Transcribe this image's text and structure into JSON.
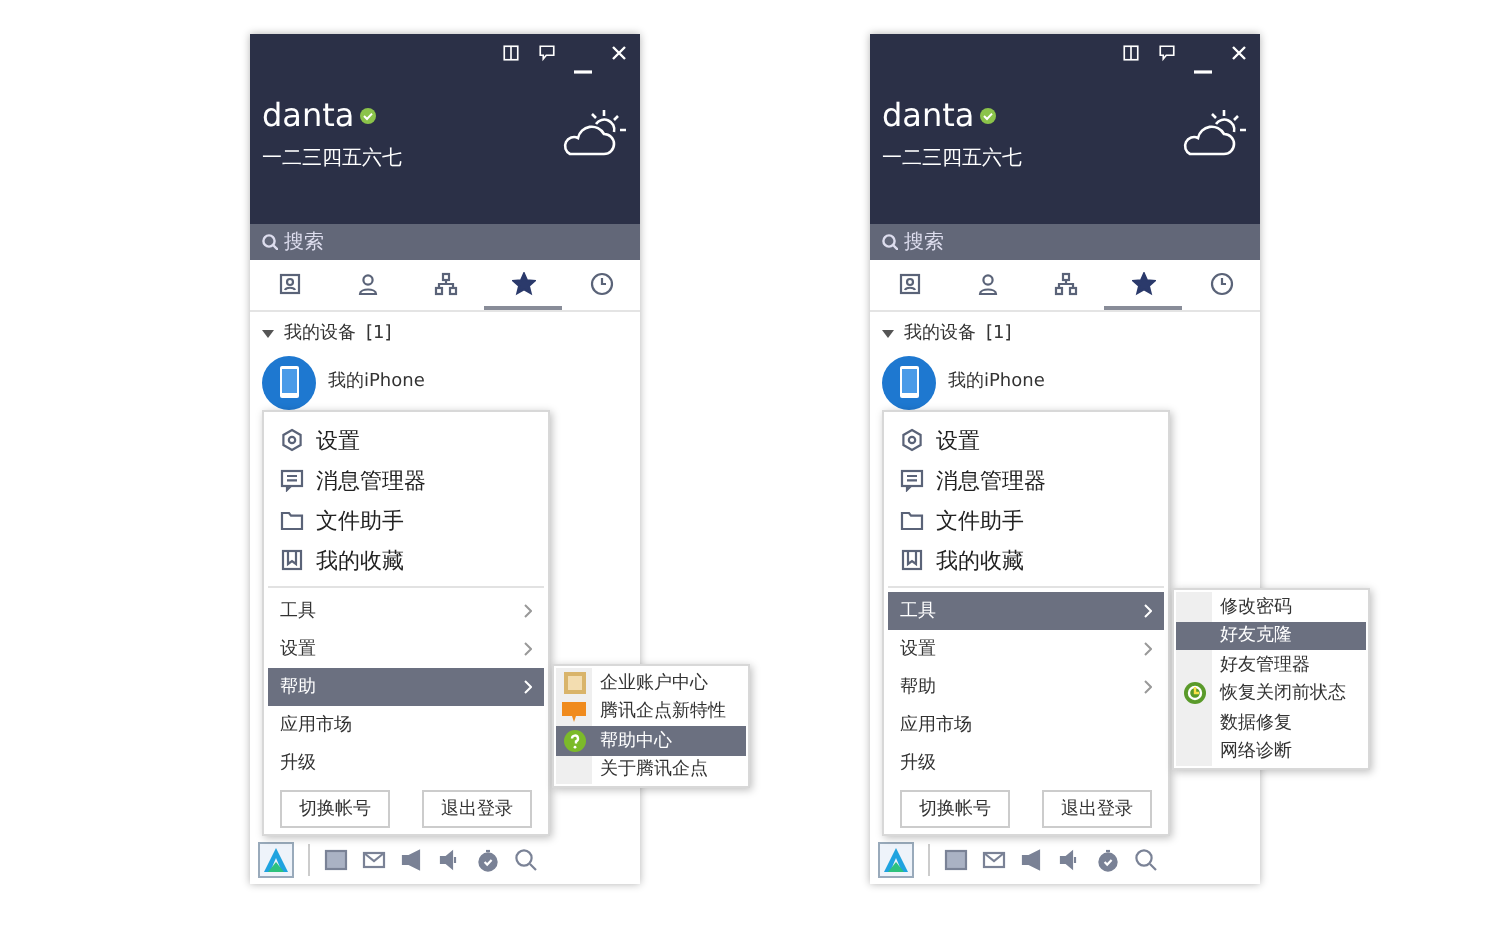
{
  "windows": [
    {
      "profile": {
        "name": "danta",
        "signature": "一二三四五六七"
      },
      "search": {
        "placeholder": "搜索"
      },
      "tabs": [
        {
          "selected": false
        },
        {
          "selected": false
        },
        {
          "selected": false
        },
        {
          "selected": true
        },
        {
          "selected": false
        }
      ],
      "group": {
        "label": "我的设备",
        "count": "[1]",
        "expanded": true
      },
      "device": {
        "name": "我的iPhone"
      },
      "menu": {
        "items": [
          {
            "kind": "large",
            "label": "设置"
          },
          {
            "kind": "large",
            "label": "消息管理器"
          },
          {
            "kind": "large",
            "label": "文件助手"
          },
          {
            "kind": "large",
            "label": "我的收藏"
          },
          {
            "kind": "submenu",
            "label": "工具",
            "selected": false
          },
          {
            "kind": "submenu",
            "label": "设置",
            "selected": false
          },
          {
            "kind": "submenu",
            "label": "帮助",
            "selected": true
          },
          {
            "kind": "plain",
            "label": "应用市场",
            "selected": false
          },
          {
            "kind": "plain",
            "label": "升级",
            "selected": false
          }
        ],
        "buttons": [
          "切换帐号",
          "退出登录"
        ],
        "submenu": [
          {
            "kind": "account",
            "label": "企业账户中心",
            "selected": false
          },
          {
            "kind": "new",
            "label": "腾讯企点新特性",
            "selected": false
          },
          {
            "kind": "help",
            "label": "帮助中心",
            "selected": true
          },
          {
            "kind": "plain",
            "label": "关于腾讯企点",
            "selected": false
          }
        ]
      }
    },
    {
      "profile": {
        "name": "danta",
        "signature": "一二三四五六七"
      },
      "search": {
        "placeholder": "搜索"
      },
      "tabs": [
        {
          "selected": false
        },
        {
          "selected": false
        },
        {
          "selected": false
        },
        {
          "selected": true
        },
        {
          "selected": false
        }
      ],
      "group": {
        "label": "我的设备",
        "count": "[1]",
        "expanded": true
      },
      "device": {
        "name": "我的iPhone"
      },
      "menu": {
        "items": [
          {
            "kind": "large",
            "label": "设置"
          },
          {
            "kind": "large",
            "label": "消息管理器"
          },
          {
            "kind": "large",
            "label": "文件助手"
          },
          {
            "kind": "large",
            "label": "我的收藏"
          },
          {
            "kind": "submenu",
            "label": "工具",
            "selected": true
          },
          {
            "kind": "submenu",
            "label": "设置",
            "selected": false
          },
          {
            "kind": "submenu",
            "label": "帮助",
            "selected": false
          },
          {
            "kind": "plain",
            "label": "应用市场",
            "selected": false
          },
          {
            "kind": "plain",
            "label": "升级",
            "selected": false
          }
        ],
        "buttons": [
          "切换帐号",
          "退出登录"
        ],
        "submenu": [
          {
            "kind": "plain",
            "label": "修改密码",
            "selected": false
          },
          {
            "kind": "plain",
            "label": "好友克隆",
            "selected": true
          },
          {
            "kind": "plain",
            "label": "好友管理器",
            "selected": false
          },
          {
            "kind": "restore",
            "label": "恢复关闭前状态",
            "selected": false
          },
          {
            "kind": "plain",
            "label": "数据修复",
            "selected": false
          },
          {
            "kind": "plain",
            "label": "网络诊断",
            "selected": false
          }
        ]
      }
    }
  ]
}
